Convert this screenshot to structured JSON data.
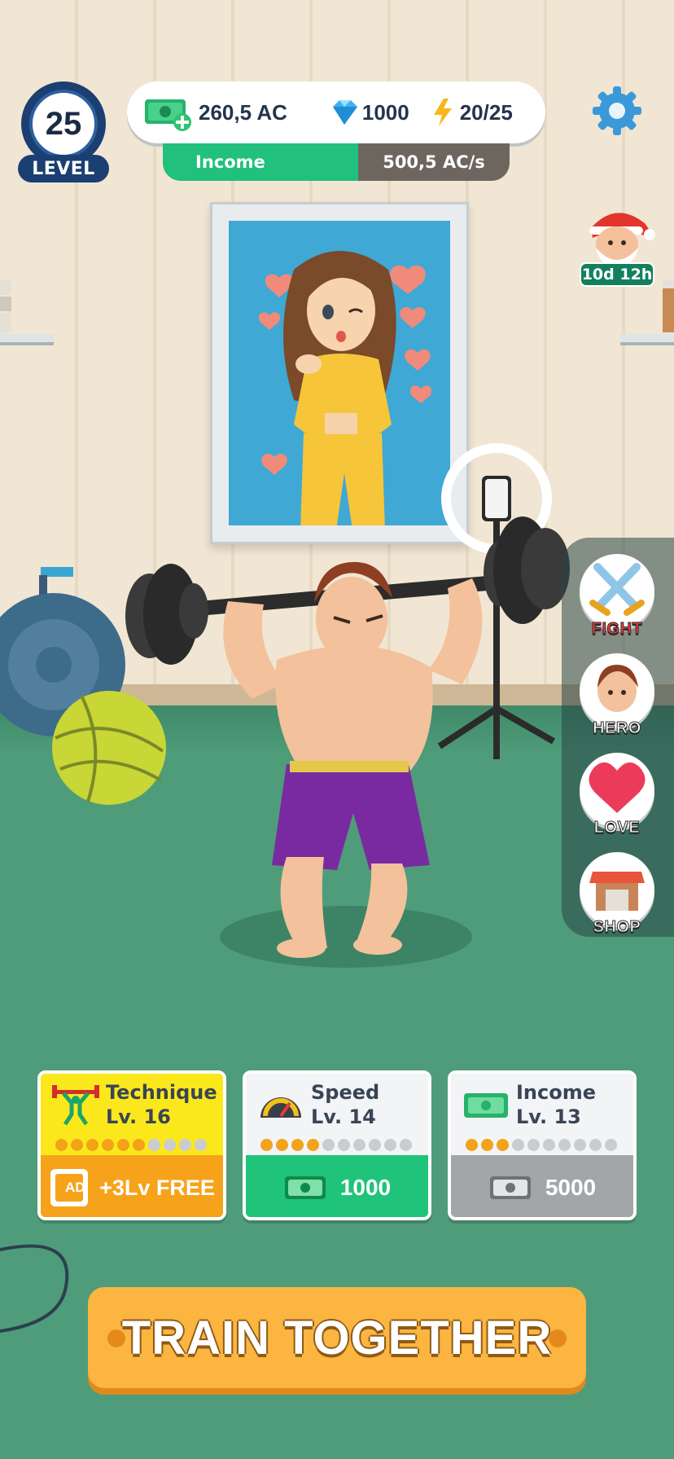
{
  "hud": {
    "level_number": "25",
    "level_label": "LEVEL",
    "cash": "260,5 AC",
    "gems": "1000",
    "energy": "20/25",
    "income_label": "Income",
    "income_rate": "500,5 AC/s"
  },
  "event": {
    "timer": "10d 12h",
    "icon": "santa-icon"
  },
  "side_menu": {
    "fight": "FIGHT",
    "hero": "HERO",
    "love": "LOVE",
    "shop": "SHOP"
  },
  "upgrades": [
    {
      "title": "Technique",
      "level": "Lv. 16",
      "progress": 6,
      "max": 10,
      "action": "+3Lv FREE",
      "action_badge": "AD",
      "color": "#fbe81c",
      "button_color": "#f6a31b"
    },
    {
      "title": "Speed",
      "level": "Lv. 14",
      "progress": 4,
      "max": 10,
      "action": "1000",
      "color": "#f2f4f6",
      "button_color": "#1fc47a"
    },
    {
      "title": "Income",
      "level": "Lv. 13",
      "progress": 3,
      "max": 10,
      "action": "5000",
      "color": "#f2f4f6",
      "button_color": "#a3a6a8"
    }
  ],
  "train_button": "TRAIN TOGETHER",
  "colors": {
    "accent_green": "#21c07c",
    "accent_orange": "#fbb540",
    "hud_navy": "#1c3f73"
  }
}
